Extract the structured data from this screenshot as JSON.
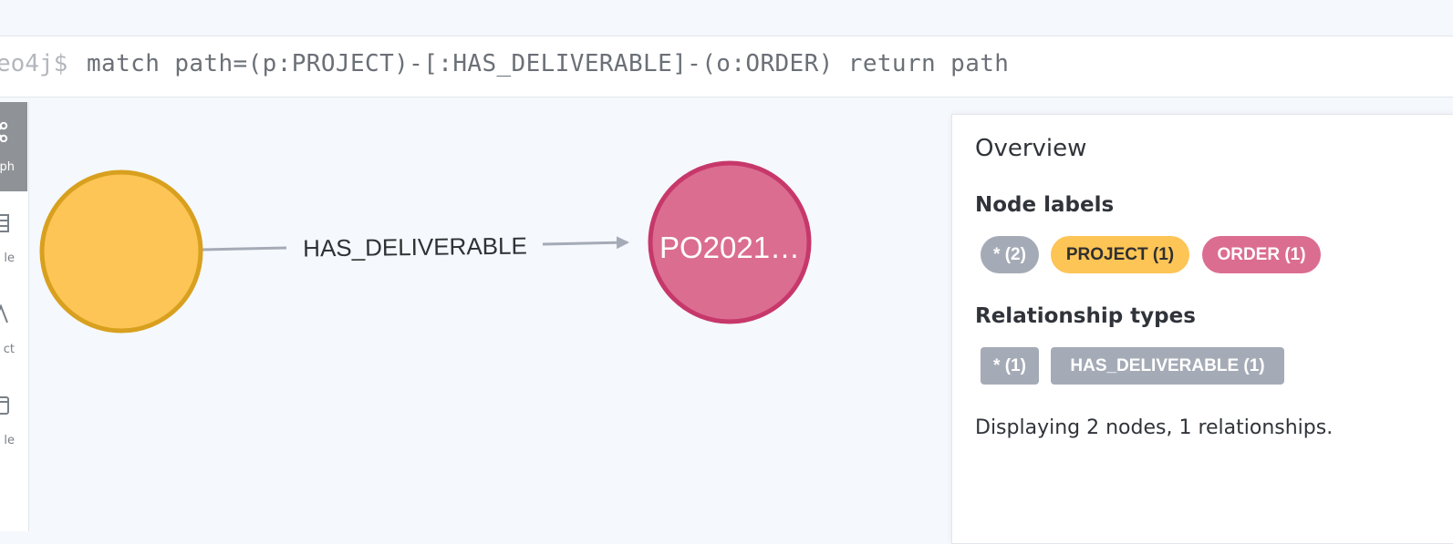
{
  "editor": {
    "prompt": "eo4j$",
    "query": "match path=(p:PROJECT)-[:HAS_DELIVERABLE]-(o:ORDER) return path"
  },
  "sidebar": {
    "items": [
      {
        "label": "ph",
        "icon": "graph-icon",
        "active": true
      },
      {
        "label": "le",
        "icon": "table-icon",
        "active": false
      },
      {
        "label": "ct",
        "icon": "text-icon",
        "active": false
      },
      {
        "label": "le",
        "icon": "code-icon",
        "active": false
      }
    ]
  },
  "graph": {
    "nodes": [
      {
        "id": "project",
        "caption": "",
        "fill": "#fdc456",
        "stroke": "#d8a01e"
      },
      {
        "id": "order",
        "caption": "PO2021…",
        "fill": "#db6d91",
        "stroke": "#c7386a"
      }
    ],
    "relationship": {
      "label": "HAS_DELIVERABLE",
      "color": "#a5abb6"
    }
  },
  "overview": {
    "title": "Overview",
    "node_labels_heading": "Node labels",
    "node_labels": [
      {
        "text": "* (2)",
        "bg": "#a5abb6",
        "fg": "#ffffff"
      },
      {
        "text": "PROJECT (1)",
        "bg": "#fdc456",
        "fg": "#2f2f2f"
      },
      {
        "text": "ORDER (1)",
        "bg": "#db6d91",
        "fg": "#ffffff"
      }
    ],
    "relationship_types_heading": "Relationship types",
    "relationship_types": [
      {
        "text": "* (1)",
        "bg": "#a5abb6"
      },
      {
        "text": "HAS_DELIVERABLE (1)",
        "bg": "#a5abb6"
      }
    ],
    "status": "Displaying 2 nodes, 1 relationships."
  }
}
